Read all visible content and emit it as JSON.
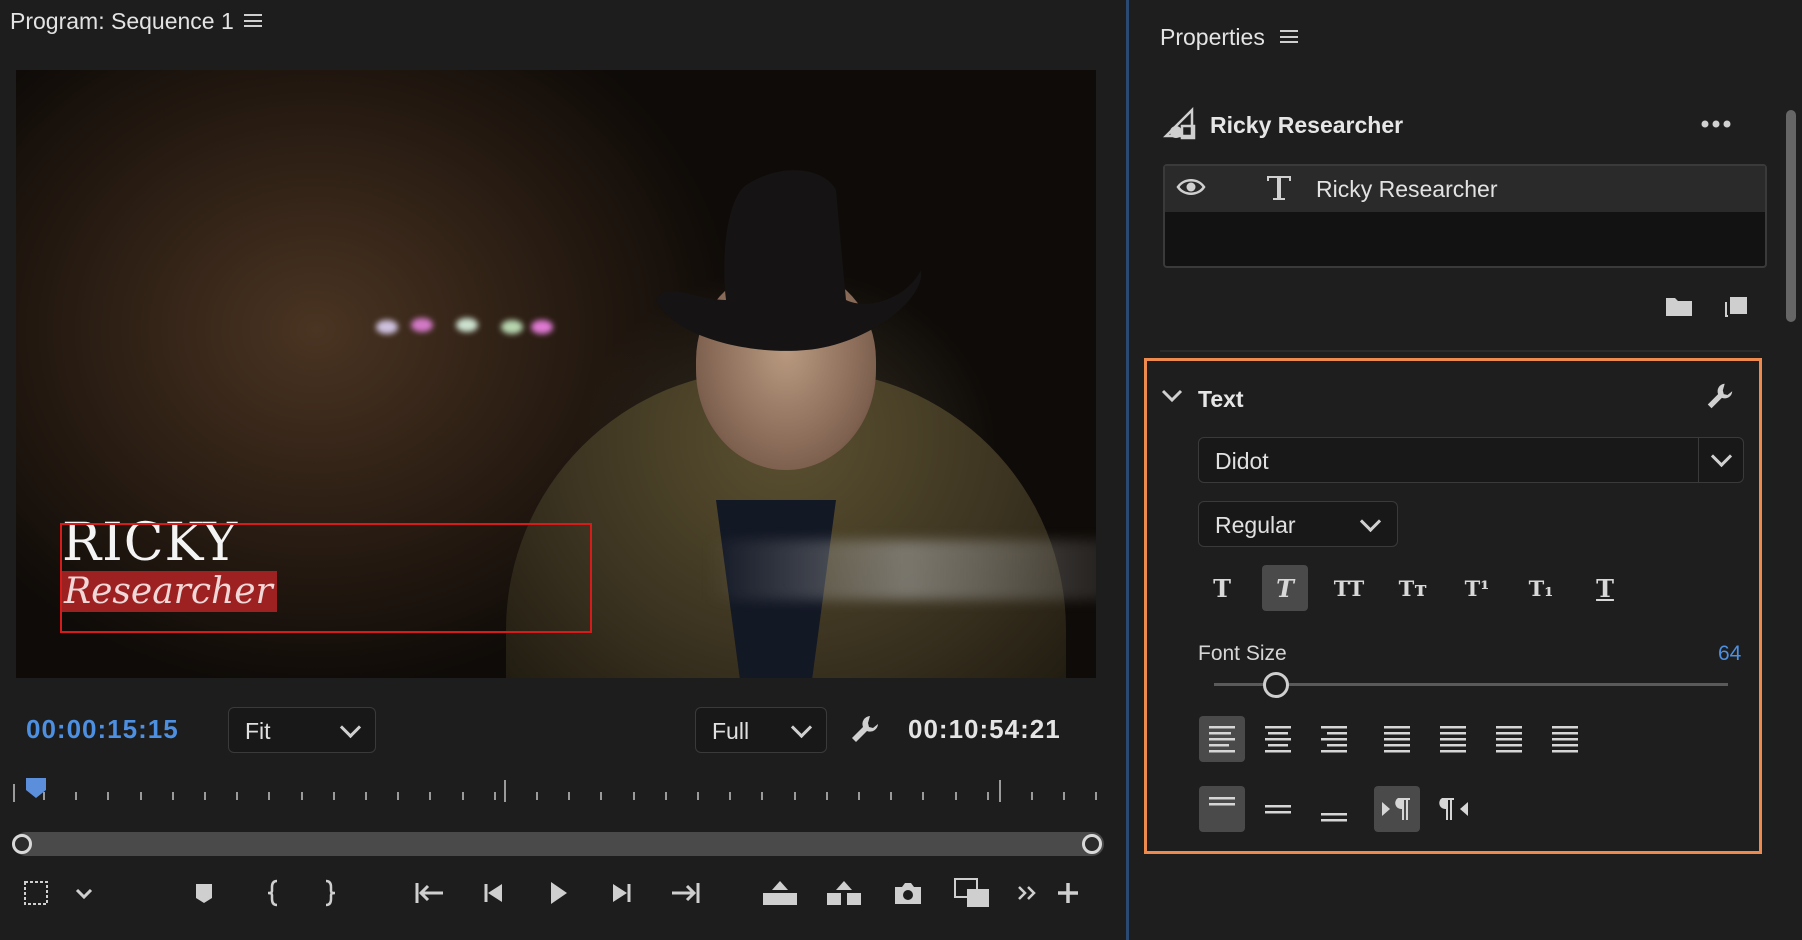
{
  "program": {
    "title": "Program: Sequence 1",
    "timecode_current": "00:00:15:15",
    "zoom": "Fit",
    "quality": "Full",
    "timecode_duration": "00:10:54:21",
    "overlay_title": {
      "name": "RICKY",
      "role": "Researcher"
    },
    "colors": {
      "timecode": "#4d8fe0",
      "selection": "#d61b1b"
    }
  },
  "properties": {
    "title": "Properties",
    "layer_group_name": "Ricky Researcher",
    "layers": [
      {
        "name": "Ricky Researcher",
        "type": "text",
        "visible": true
      }
    ],
    "text_section": {
      "title": "Text",
      "font": "Didot",
      "style": "Regular",
      "font_size_label": "Font Size",
      "font_size_value": "64",
      "font_size_fraction": 0.12,
      "formatting_buttons": [
        {
          "name": "faux-bold",
          "glyph": "T",
          "active": false
        },
        {
          "name": "faux-italic",
          "glyph": "T",
          "active": true
        },
        {
          "name": "all-caps",
          "glyph": "TT",
          "active": false
        },
        {
          "name": "small-caps",
          "glyph": "Tт",
          "active": false
        },
        {
          "name": "superscript",
          "glyph": "T¹",
          "active": false
        },
        {
          "name": "subscript",
          "glyph": "T₁",
          "active": false
        },
        {
          "name": "underline",
          "glyph": "T",
          "active": false
        }
      ],
      "highlight_color": "#ef8a4f"
    }
  }
}
